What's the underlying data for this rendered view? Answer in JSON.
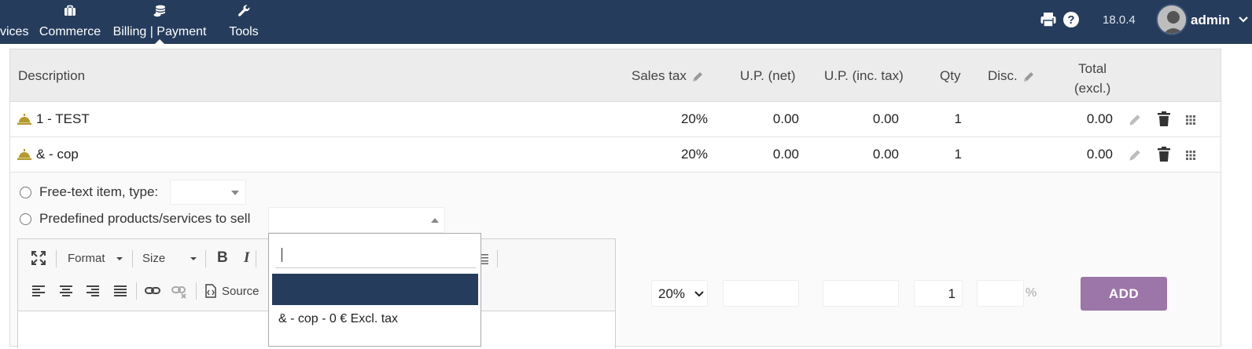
{
  "topbar": {
    "nav": [
      {
        "label": "vices",
        "icon": "services-icon"
      },
      {
        "label": "Commerce",
        "icon": "briefcase-icon"
      },
      {
        "label": "Billing | Payment",
        "icon": "coins-icon",
        "active": true
      },
      {
        "label": "Tools",
        "icon": "wrench-icon"
      }
    ],
    "version": "18.0.4",
    "username": "admin",
    "bg_color": "#263c5c"
  },
  "table": {
    "headers": {
      "description": "Description",
      "sales_tax": "Sales tax",
      "up_net": "U.P. (net)",
      "up_inc": "U.P. (inc. tax)",
      "qty": "Qty",
      "disc": "Disc.",
      "total_line1": "Total",
      "total_line2": "(excl.)"
    },
    "rows": [
      {
        "description": "1 - TEST",
        "sales_tax": "20%",
        "up_net": "0.00",
        "up_inc": "0.00",
        "qty": "1",
        "total": "0.00"
      },
      {
        "description": "& - cop",
        "sales_tax": "20%",
        "up_net": "0.00",
        "up_inc": "0.00",
        "qty": "1",
        "total": "0.00"
      }
    ]
  },
  "form": {
    "free_text_label": "Free-text item, type:",
    "predefined_label": "Predefined products/services to sell",
    "editor": {
      "format_label": "Format",
      "size_label": "Size",
      "bold_label": "B",
      "italic_label": "I",
      "source_label": "Source"
    },
    "vat_value": "20%",
    "qty_value": "1",
    "pct_suffix": "%",
    "add_label": "ADD"
  },
  "dropdown": {
    "option": "& - cop - 0 € Excl. tax"
  },
  "colors": {
    "accent": "#263c5c",
    "add_button": "#9c75a9",
    "service_icon": "#b59a2c"
  }
}
